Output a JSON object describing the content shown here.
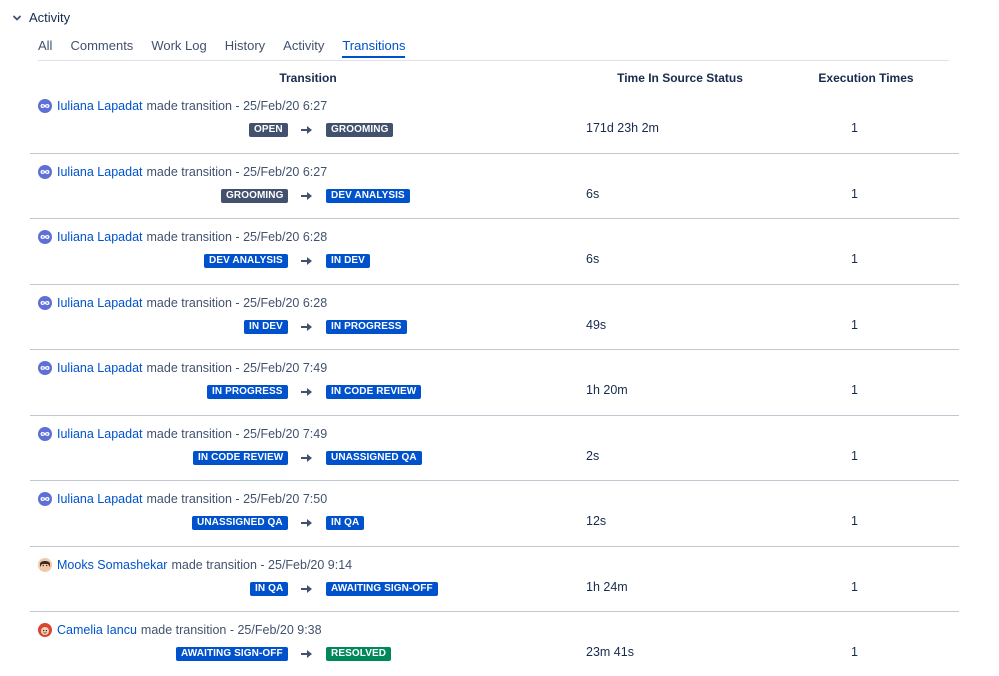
{
  "section": {
    "title": "Activity",
    "icon": "chevron-down-icon"
  },
  "tabs": [
    {
      "label": "All",
      "active": false
    },
    {
      "label": "Comments",
      "active": false
    },
    {
      "label": "Work Log",
      "active": false
    },
    {
      "label": "History",
      "active": false
    },
    {
      "label": "Activity",
      "active": false
    },
    {
      "label": "Transitions",
      "active": true
    }
  ],
  "columns": {
    "transition": "Transition",
    "time": "Time In Source Status",
    "exec": "Execution Times"
  },
  "colors": {
    "link": "#0052cc",
    "lozenge_grey": "#42526e",
    "lozenge_blue": "#0052cc",
    "lozenge_green": "#00875a"
  },
  "rows": [
    {
      "user": "Iuliana Lapadat",
      "avatar": "infinity-avatar-icon",
      "action": "made transition - 25/Feb/20 6:27",
      "from": {
        "label": "OPEN",
        "color": "grey"
      },
      "to": {
        "label": "GROOMING",
        "color": "grey"
      },
      "time": "171d 23h 2m",
      "exec": "1"
    },
    {
      "user": "Iuliana Lapadat",
      "avatar": "infinity-avatar-icon",
      "action": "made transition - 25/Feb/20 6:27",
      "from": {
        "label": "GROOMING",
        "color": "grey"
      },
      "to": {
        "label": "DEV ANALYSIS",
        "color": "blue"
      },
      "time": "6s",
      "exec": "1"
    },
    {
      "user": "Iuliana Lapadat",
      "avatar": "infinity-avatar-icon",
      "action": "made transition - 25/Feb/20 6:28",
      "from": {
        "label": "DEV ANALYSIS",
        "color": "blue"
      },
      "to": {
        "label": "IN DEV",
        "color": "blue"
      },
      "time": "6s",
      "exec": "1"
    },
    {
      "user": "Iuliana Lapadat",
      "avatar": "infinity-avatar-icon",
      "action": "made transition - 25/Feb/20 6:28",
      "from": {
        "label": "IN DEV",
        "color": "blue"
      },
      "to": {
        "label": "IN PROGRESS",
        "color": "blue"
      },
      "time": "49s",
      "exec": "1"
    },
    {
      "user": "Iuliana Lapadat",
      "avatar": "infinity-avatar-icon",
      "action": "made transition - 25/Feb/20 7:49",
      "from": {
        "label": "IN PROGRESS",
        "color": "blue"
      },
      "to": {
        "label": "IN CODE REVIEW",
        "color": "blue"
      },
      "time": "1h 20m",
      "exec": "1"
    },
    {
      "user": "Iuliana Lapadat",
      "avatar": "infinity-avatar-icon",
      "action": "made transition - 25/Feb/20 7:49",
      "from": {
        "label": "IN CODE REVIEW",
        "color": "blue"
      },
      "to": {
        "label": "UNASSIGNED QA",
        "color": "blue"
      },
      "time": "2s",
      "exec": "1"
    },
    {
      "user": "Iuliana Lapadat",
      "avatar": "infinity-avatar-icon",
      "action": "made transition - 25/Feb/20 7:50",
      "from": {
        "label": "UNASSIGNED QA",
        "color": "blue"
      },
      "to": {
        "label": "IN QA",
        "color": "blue"
      },
      "time": "12s",
      "exec": "1"
    },
    {
      "user": "Mooks Somashekar",
      "avatar": "person-avatar-icon",
      "action": "made transition - 25/Feb/20 9:14",
      "from": {
        "label": "IN QA",
        "color": "blue"
      },
      "to": {
        "label": "AWAITING SIGN-OFF",
        "color": "blue"
      },
      "time": "1h 24m",
      "exec": "1"
    },
    {
      "user": "Camelia Iancu",
      "avatar": "cartoon-avatar-icon",
      "action": "made transition - 25/Feb/20 9:38",
      "from": {
        "label": "AWAITING SIGN-OFF",
        "color": "blue"
      },
      "to": {
        "label": "RESOLVED",
        "color": "green"
      },
      "time": "23m 41s",
      "exec": "1"
    }
  ]
}
